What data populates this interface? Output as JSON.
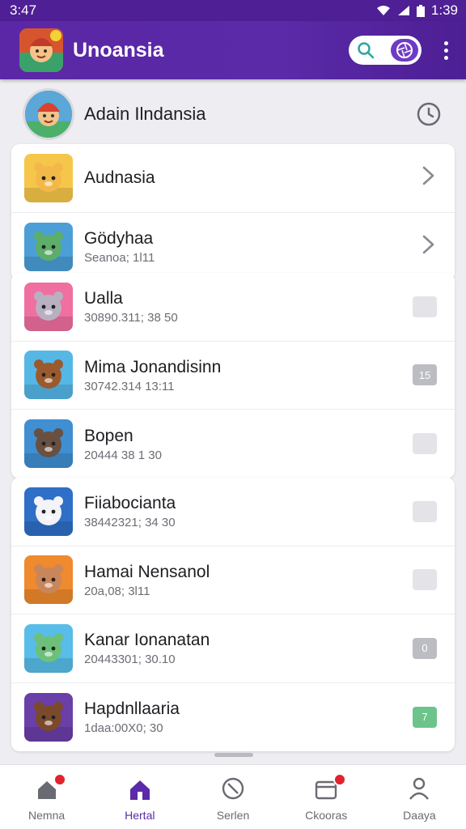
{
  "status_bar": {
    "time_left": "3:47",
    "time_right": "1:39"
  },
  "app_bar": {
    "title": "Unoansia"
  },
  "pinned": {
    "name": "Adain Ilndansia"
  },
  "cards": [
    {
      "rows": [
        {
          "name": "Audnasia",
          "sub": "",
          "trailing": "chevron",
          "icon": "lion-avatar-icon",
          "bg": "#f6c64a"
        },
        {
          "name": "Gödyhaa",
          "sub": "Seanoa; 1l11",
          "trailing": "chevron",
          "icon": "unicorn-avatar-icon",
          "bg": "#4b9fd6"
        }
      ]
    },
    {
      "rows": [
        {
          "name": "Ualla",
          "sub": "30890.311; 38 50",
          "trailing": "box",
          "box_text": "",
          "box_style": "",
          "icon": "mouse-avatar-icon",
          "bg": "#ef6fa0"
        },
        {
          "name": "Mima Jonandisinn",
          "sub": "30742.314 13:11",
          "trailing": "box",
          "box_text": "15",
          "box_style": "gray",
          "icon": "bear-avatar-icon",
          "bg": "#55b7e6"
        },
        {
          "name": "Bopen",
          "sub": "20444 38 1 30",
          "trailing": "box",
          "box_text": "",
          "box_style": "",
          "icon": "cat-avatar-icon",
          "bg": "#3f8fd2"
        }
      ]
    },
    {
      "rows": [
        {
          "name": "Fiiabocianta",
          "sub": "38442321; 34 30",
          "trailing": "box",
          "box_text": "",
          "box_style": "",
          "icon": "fox-avatar-icon",
          "bg": "#2f6fc8"
        },
        {
          "name": "Hamai Nensanol",
          "sub": "20a,08; 3l11",
          "trailing": "box",
          "box_text": "",
          "box_style": "",
          "icon": "kid-avatar-icon",
          "bg": "#ef8a2e"
        },
        {
          "name": "Kanar Ionanatan",
          "sub": "20443301; 30.10",
          "trailing": "box",
          "box_text": "0",
          "box_style": "gray",
          "icon": "dino-avatar-icon",
          "bg": "#58bde8"
        },
        {
          "name": "Hapdnllaaria",
          "sub": "1daa:00X0; 30",
          "trailing": "box",
          "box_text": "7",
          "box_style": "green",
          "icon": "moose-avatar-icon",
          "bg": "#6a3fa8"
        }
      ]
    }
  ],
  "bottom_nav": [
    {
      "label": "Nemna",
      "icon": "home-icon",
      "active": false,
      "badge": true
    },
    {
      "label": "Hertal",
      "icon": "house-filled-icon",
      "active": true,
      "badge": false
    },
    {
      "label": "Serlen",
      "icon": "compass-icon",
      "active": false,
      "badge": false
    },
    {
      "label": "Ckooras",
      "icon": "inbox-icon",
      "active": false,
      "badge": true
    },
    {
      "label": "Daaya",
      "icon": "profile-icon",
      "active": false,
      "badge": false
    }
  ],
  "colors": {
    "primary": "#5a2aa8",
    "badge": "#e0232e",
    "green": "#6cc48a"
  }
}
